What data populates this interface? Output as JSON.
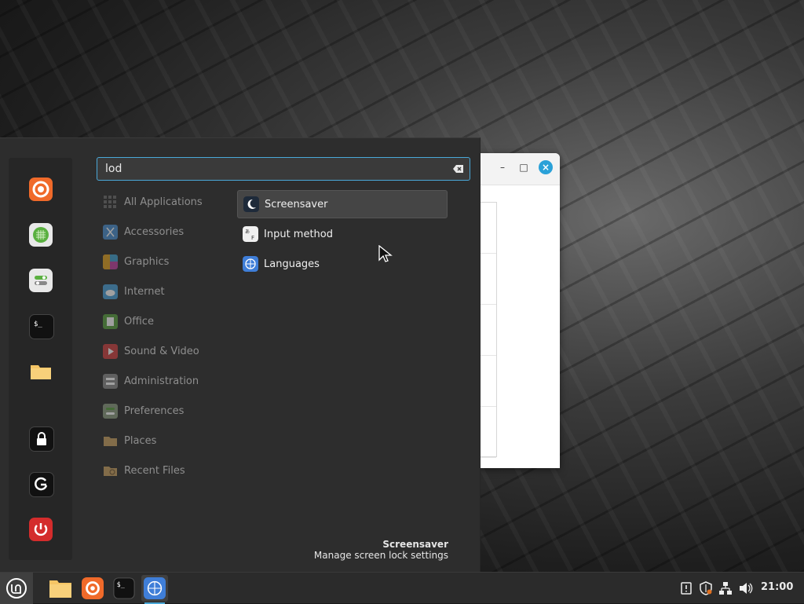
{
  "search": {
    "value": "lod"
  },
  "categories": [
    {
      "label": "All Applications",
      "icon": "grid-icon",
      "color": "#6b6b6b"
    },
    {
      "label": "Accessories",
      "icon": "scissors-icon",
      "color": "#4a8fd0"
    },
    {
      "label": "Graphics",
      "icon": "palette-icon",
      "color": "#c040a0"
    },
    {
      "label": "Internet",
      "icon": "cloud-icon",
      "color": "#4aa0d8"
    },
    {
      "label": "Office",
      "icon": "office-icon",
      "color": "#5aa040"
    },
    {
      "label": "Sound & Video",
      "icon": "play-icon",
      "color": "#d04040"
    },
    {
      "label": "Administration",
      "icon": "admin-icon",
      "color": "#8a8a8a"
    },
    {
      "label": "Preferences",
      "icon": "preferences-icon",
      "color": "#8a9a80"
    },
    {
      "label": "Places",
      "icon": "folder-icon",
      "color": "#c8a060"
    },
    {
      "label": "Recent Files",
      "icon": "recent-folder-icon",
      "color": "#c8a060"
    }
  ],
  "results": [
    {
      "label": "Screensaver",
      "icon": "moon-icon"
    },
    {
      "label": "Input method",
      "icon": "keyboard-icon"
    },
    {
      "label": "Languages",
      "icon": "globe-icon"
    }
  ],
  "description": {
    "title": "Screensaver",
    "subtitle": "Manage screen lock settings"
  },
  "taskbar": {
    "clock": "21:00"
  },
  "colors": {
    "accent": "#4aa8d8",
    "menu_bg": "#2d2d2d",
    "firefox": "#f06a2a",
    "power": "#d42c2c"
  }
}
